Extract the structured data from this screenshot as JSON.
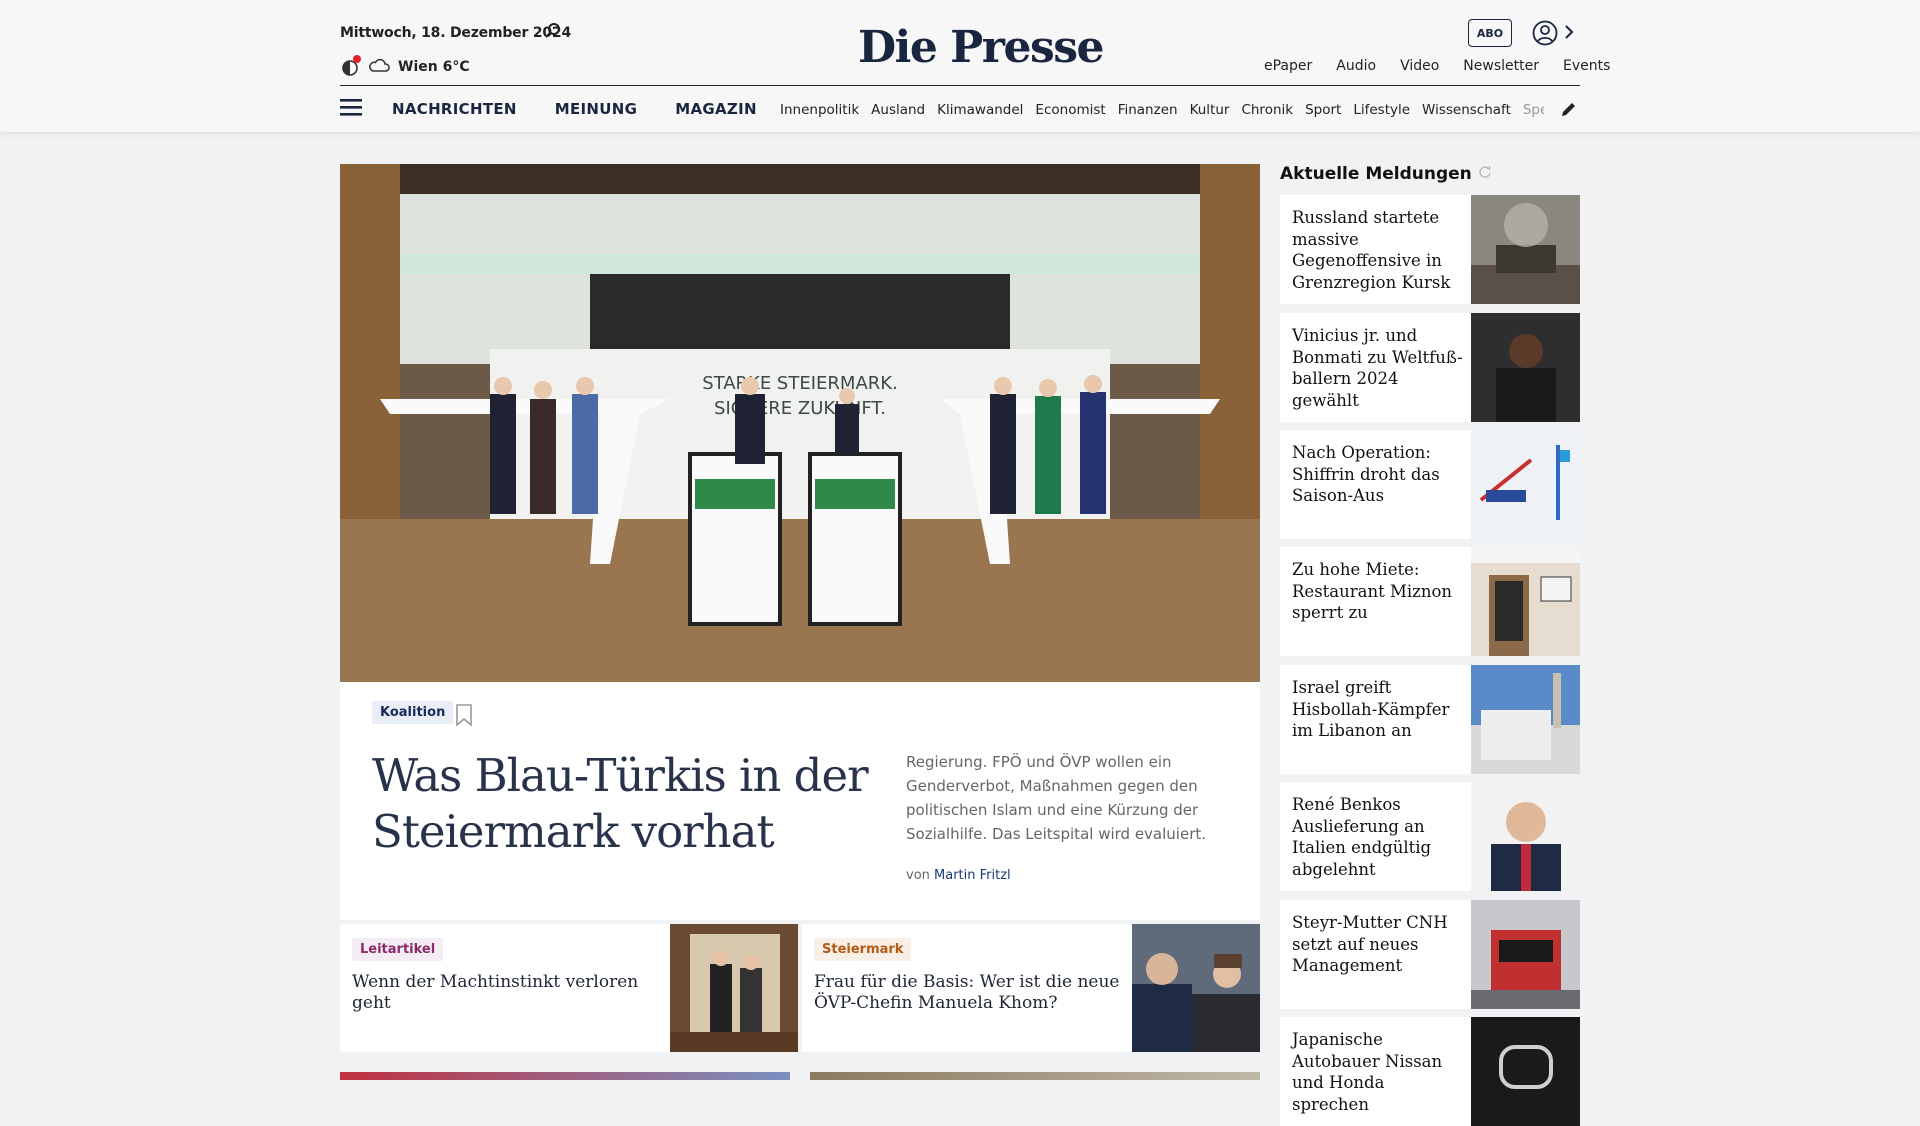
{
  "header": {
    "date": "Mittwoch, 18. Dezember 2024",
    "weather": "Wien 6°C",
    "logo": "Die Presse",
    "abo": "ABO",
    "links": [
      "ePaper",
      "Audio",
      "Video",
      "Newsletter",
      "Events"
    ]
  },
  "nav": {
    "main": [
      "NACHRICHTEN",
      "MEINUNG",
      "MAGAZIN"
    ],
    "sub": [
      "Innenpolitik",
      "Ausland",
      "Klimawandel",
      "Economist",
      "Finanzen",
      "Kultur",
      "Chronik",
      "Sport",
      "Lifestyle",
      "Wissenschaft",
      "Spectrum"
    ]
  },
  "hero": {
    "backdrop_text_1": "STARKE STEIERMARK.",
    "backdrop_text_2": "SICHERE ZUKUNFT.",
    "tag": "Koalition",
    "headline": "Was Blau-Türkis in der Steiermark vorhat",
    "teaser": "Regierung. FPÖ und ÖVP wollen ein Genderverbot, Maßnahmen gegen den politischen Islam und eine Kürzung der Sozialhilfe. Das Leitspital wird evaluiert.",
    "byline_prefix": "von",
    "author": "Martin Fritzl"
  },
  "cards": [
    {
      "tag": "Leitartikel",
      "title": "Wenn der Machtinstinkt verloren geht"
    },
    {
      "tag": "Steiermark",
      "title": "Frau für die Basis: Wer ist die neue ÖVP-Chefin Manuela Khom?"
    }
  ],
  "aside": {
    "title": "Aktuelle Meldungen",
    "items": [
      "Russland startete massive Gegenoffensive in Grenzregion Kursk",
      "Vinicius jr. und Bonmati zu Weltfuß­ballern 2024 gewählt",
      "Nach Operation: Shiffrin droht das Saison-Aus",
      "Zu hohe Miete: Restaurant Miznon sperrt zu",
      "Israel greift Hisbollah-Kämpfer im Libanon an",
      "René Benkos Auslieferung an Italien endgültig abgelehnt",
      "Steyr-Mutter CNH setzt auf neues Management",
      "Japanische Autobauer Nissan und Honda sprechen"
    ]
  },
  "colors": {
    "accent": "#1a2540",
    "leitartikel": "#8a2a6a",
    "steiermark": "#b25a17"
  }
}
